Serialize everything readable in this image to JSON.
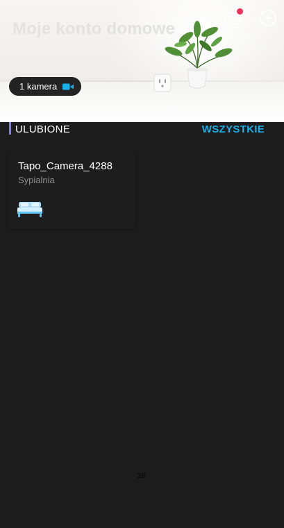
{
  "header": {
    "title": "Moje konto domowe",
    "camera_chip": {
      "label": "1 kamera",
      "icon": "video-camera-icon"
    },
    "actions": [
      {
        "name": "mail",
        "icon": "envelope-icon",
        "has_notification": true
      },
      {
        "name": "add",
        "icon": "plus-circle-icon"
      }
    ]
  },
  "favorites": {
    "title": "ULUBIONE",
    "see_all": "WSZYSTKIE",
    "devices": [
      {
        "name": "Tapo_Camera_4288",
        "room": "Sypialnia",
        "room_icon": "bed-icon"
      }
    ]
  },
  "footer": {
    "page_number": "28"
  },
  "colors": {
    "background": "#1c1c1c",
    "accent_link": "#19b0e8",
    "section_marker": "#7d7ff0",
    "notification": "#f0325b",
    "camera_icon": "#17b1eb"
  }
}
